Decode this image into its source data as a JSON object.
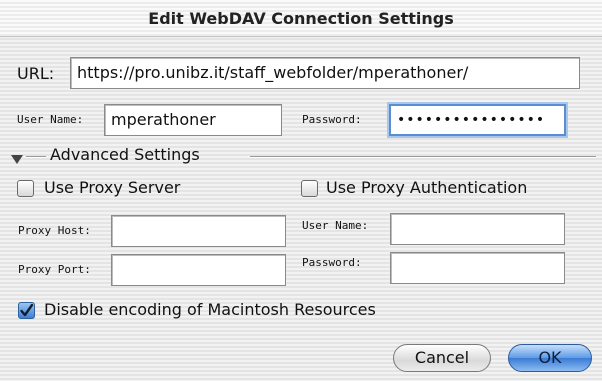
{
  "window": {
    "title": "Edit WebDAV Connection Settings"
  },
  "url": {
    "label": "URL:",
    "value": "https://pro.unibz.it/staff_webfolder/mperathoner/"
  },
  "credentials": {
    "user_label": "User Name:",
    "user_value": "mperathoner",
    "password_label": "Password:",
    "password_value": "••••••••••••••••"
  },
  "advanced": {
    "label": "Advanced Settings",
    "expanded": true
  },
  "proxy": {
    "use_proxy_server": {
      "label": "Use Proxy Server",
      "checked": false
    },
    "use_proxy_auth": {
      "label": "Use Proxy Authentication",
      "checked": false
    },
    "host_label": "Proxy Host:",
    "host_value": "",
    "port_label": "Proxy Port:",
    "port_value": "",
    "user_label": "User Name:",
    "user_value": "",
    "password_label": "Password:",
    "password_value": ""
  },
  "disable_encoding": {
    "label": "Disable encoding of Macintosh Resources",
    "checked": true
  },
  "buttons": {
    "cancel": "Cancel",
    "ok": "OK"
  },
  "colors": {
    "accent": "#3a7bd6",
    "focus_ring": "#a9c7ec"
  }
}
